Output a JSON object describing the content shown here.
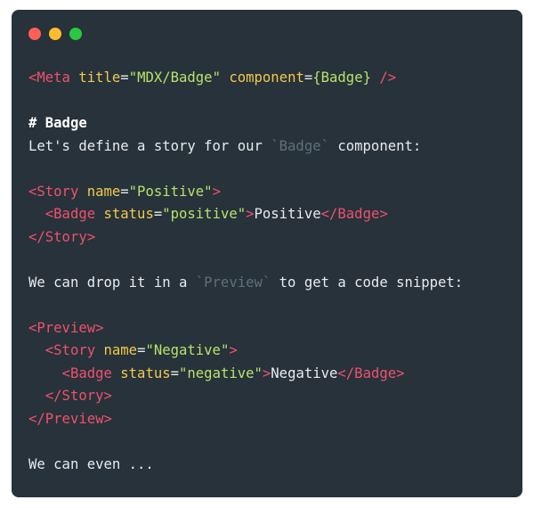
{
  "window": {
    "controls": [
      {
        "name": "close",
        "color": "#ff5f57"
      },
      {
        "name": "minimize",
        "color": "#febc2e"
      },
      {
        "name": "maximize",
        "color": "#28c840"
      }
    ]
  },
  "code": {
    "lines": [
      [
        {
          "t": "tag",
          "v": "<Meta "
        },
        {
          "t": "attr",
          "v": "title"
        },
        {
          "t": "text",
          "v": "="
        },
        {
          "t": "str",
          "v": "\"MDX/Badge\""
        },
        {
          "t": "text",
          "v": " "
        },
        {
          "t": "attr",
          "v": "component"
        },
        {
          "t": "text",
          "v": "="
        },
        {
          "t": "str",
          "v": "{Badge}"
        },
        {
          "t": "text",
          "v": " "
        },
        {
          "t": "tag",
          "v": "/>"
        }
      ],
      [],
      [
        {
          "t": "heading",
          "v": "# Badge"
        }
      ],
      [
        {
          "t": "text",
          "v": "Let's define a story for our "
        },
        {
          "t": "dim",
          "v": "`Badge`"
        },
        {
          "t": "text",
          "v": " component:"
        }
      ],
      [],
      [
        {
          "t": "tag",
          "v": "<Story "
        },
        {
          "t": "attr",
          "v": "name"
        },
        {
          "t": "text",
          "v": "="
        },
        {
          "t": "str",
          "v": "\"Positive\""
        },
        {
          "t": "tag",
          "v": ">"
        }
      ],
      [
        {
          "t": "text",
          "v": "  "
        },
        {
          "t": "tag",
          "v": "<Badge "
        },
        {
          "t": "attr",
          "v": "status"
        },
        {
          "t": "text",
          "v": "="
        },
        {
          "t": "str",
          "v": "\"positive\""
        },
        {
          "t": "tag",
          "v": ">"
        },
        {
          "t": "text",
          "v": "Positive"
        },
        {
          "t": "tag",
          "v": "</Badge>"
        }
      ],
      [
        {
          "t": "tag",
          "v": "</Story>"
        }
      ],
      [],
      [
        {
          "t": "text",
          "v": "We can drop it in a "
        },
        {
          "t": "dim",
          "v": "`Preview`"
        },
        {
          "t": "text",
          "v": " to get a code snippet:"
        }
      ],
      [],
      [
        {
          "t": "tag",
          "v": "<Preview>"
        }
      ],
      [
        {
          "t": "text",
          "v": "  "
        },
        {
          "t": "tag",
          "v": "<Story "
        },
        {
          "t": "attr",
          "v": "name"
        },
        {
          "t": "text",
          "v": "="
        },
        {
          "t": "str",
          "v": "\"Negative\""
        },
        {
          "t": "tag",
          "v": ">"
        }
      ],
      [
        {
          "t": "text",
          "v": "    "
        },
        {
          "t": "tag",
          "v": "<Badge "
        },
        {
          "t": "attr",
          "v": "status"
        },
        {
          "t": "text",
          "v": "="
        },
        {
          "t": "str",
          "v": "\"negative\""
        },
        {
          "t": "tag",
          "v": ">"
        },
        {
          "t": "text",
          "v": "Negative"
        },
        {
          "t": "tag",
          "v": "</Badge>"
        }
      ],
      [
        {
          "t": "text",
          "v": "  "
        },
        {
          "t": "tag",
          "v": "</Story>"
        }
      ],
      [
        {
          "t": "tag",
          "v": "</Preview>"
        }
      ],
      [],
      [
        {
          "t": "text",
          "v": "We can even ..."
        }
      ]
    ]
  }
}
